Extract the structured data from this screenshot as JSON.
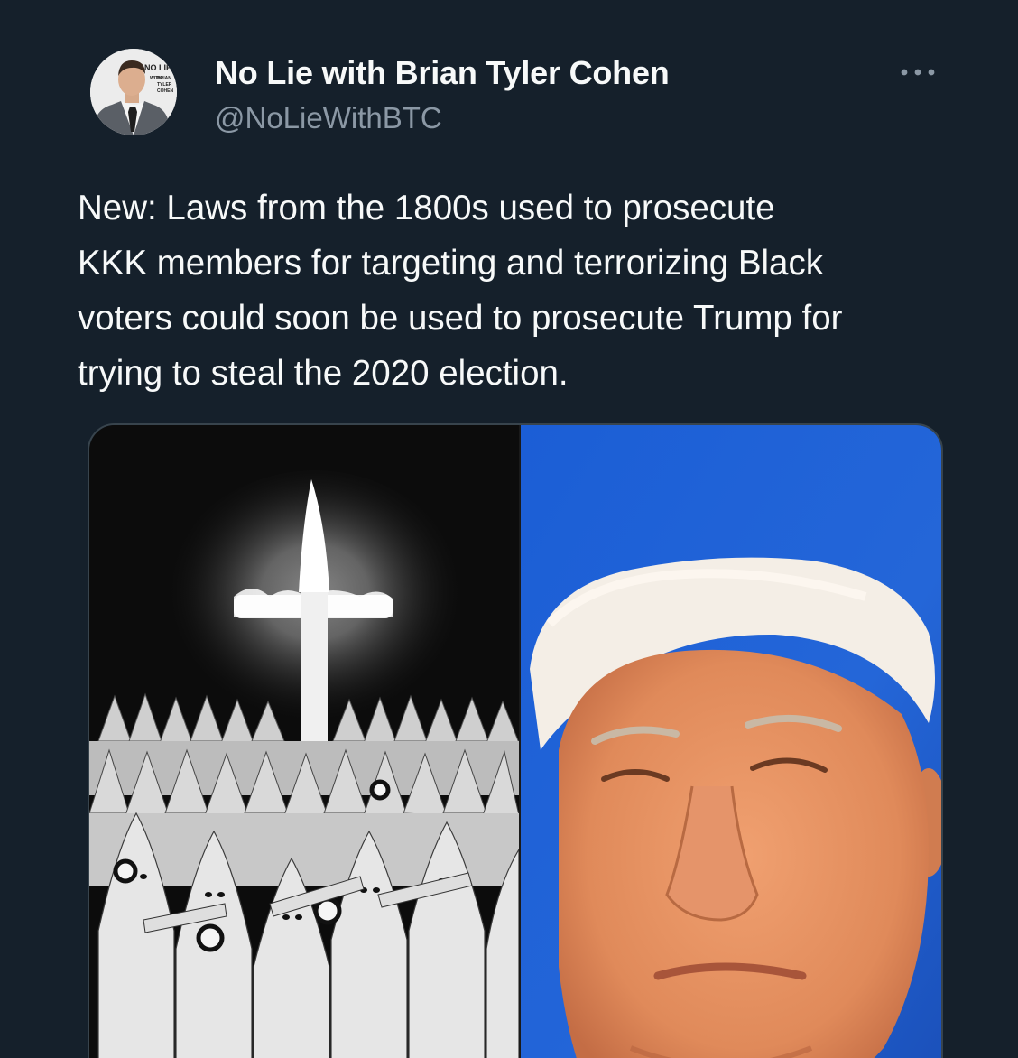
{
  "author": {
    "name": "No Lie with Brian Tyler Cohen",
    "handle": "@NoLieWithBTC",
    "avatar_logo_text": [
      "NO LIE",
      "WITH",
      "BRIAN",
      "TYLER",
      "COHEN"
    ]
  },
  "tweet": {
    "text": "New: Laws from the 1800s used to prosecute\nKKK members for targeting and terrorizing Black\nvoters could soon be used to prosecute Trump for\ntrying to steal the 2020 election."
  },
  "icons": {
    "more": "more-horizontal-icon"
  },
  "colors": {
    "background": "#15202b",
    "text_primary": "#f7f9f9",
    "text_secondary": "#8b98a5",
    "border": "#38444d"
  }
}
